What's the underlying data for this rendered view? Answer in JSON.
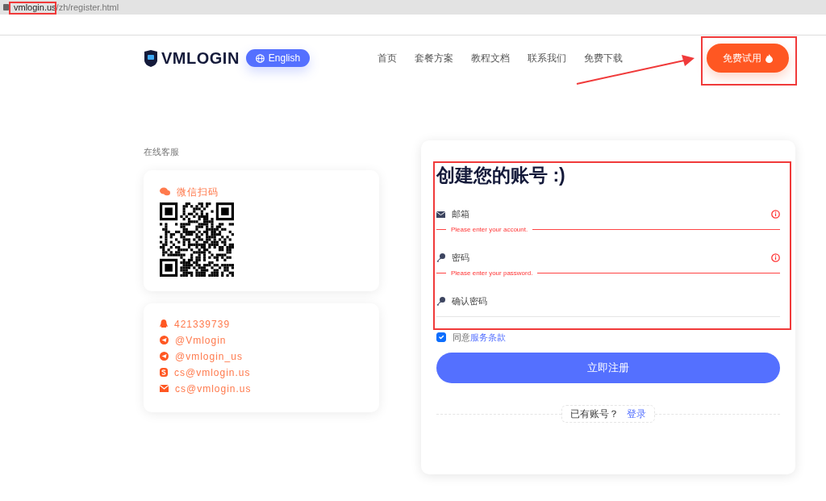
{
  "address_bar": {
    "host": "vmlogin.us",
    "path": "/zh/register.html"
  },
  "header": {
    "brand": "VMLOGIN",
    "language": "English",
    "nav": [
      "首页",
      "套餐方案",
      "教程文档",
      "联系我们",
      "免费下载"
    ],
    "trial_button": "免费试用"
  },
  "support": {
    "title": "在线客服",
    "wechat_label": "微信扫码",
    "contacts": [
      {
        "kind": "qq",
        "text": "421339739"
      },
      {
        "kind": "telegram",
        "text": "@Vmlogin"
      },
      {
        "kind": "telegram",
        "text": "@vmlogin_us"
      },
      {
        "kind": "skype",
        "text": "cs@vmlogin.us"
      },
      {
        "kind": "mail",
        "text": "cs@vmlogin.us"
      }
    ]
  },
  "form": {
    "title": "创建您的账号 :)",
    "fields": [
      {
        "kind": "email",
        "placeholder": "邮箱",
        "invalid": true,
        "error": "Please enter your account."
      },
      {
        "kind": "password",
        "placeholder": "密码",
        "invalid": true,
        "error": "Please enter your password."
      },
      {
        "kind": "password",
        "placeholder": "确认密码",
        "invalid": false
      }
    ],
    "agree": {
      "checked": true,
      "text": "同意",
      "link": "服务条款"
    },
    "submit": "立即注册",
    "login_prompt": "已有账号？",
    "login_link": "登录"
  }
}
